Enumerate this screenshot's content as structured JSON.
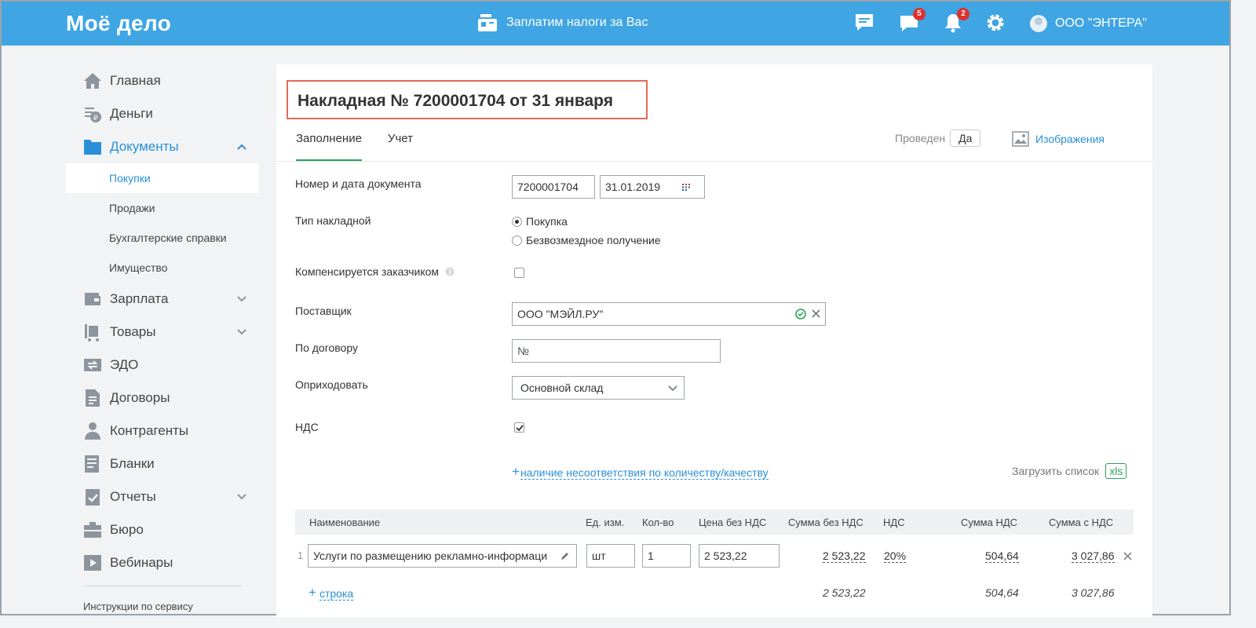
{
  "header": {
    "logo": "Моё дело",
    "tax_label": "Заплатим налоги за Вас",
    "messages_badge": "5",
    "notifications_badge": "2",
    "company": "ООО \"ЭНТЕРА\""
  },
  "sidebar": {
    "items": [
      {
        "label": "Главная"
      },
      {
        "label": "Деньги"
      },
      {
        "label": "Документы"
      },
      {
        "label": "Зарплата"
      },
      {
        "label": "Товары"
      },
      {
        "label": "ЭДО"
      },
      {
        "label": "Договоры"
      },
      {
        "label": "Контрагенты"
      },
      {
        "label": "Бланки"
      },
      {
        "label": "Отчеты"
      },
      {
        "label": "Бюро"
      },
      {
        "label": "Вебинары"
      }
    ],
    "sub": [
      "Покупки",
      "Продажи",
      "Бухгалтерские справки",
      "Имущество"
    ],
    "help": "Инструкции по сервису"
  },
  "doc": {
    "title": "Накладная № 7200001704 от 31 января",
    "tabs": [
      "Заполнение",
      "Учет"
    ],
    "posted_label": "Проведен",
    "posted_value": "Да",
    "images_label": "Изображения"
  },
  "form": {
    "number_label": "Номер и дата документа",
    "number": "7200001704",
    "date": "31.01.2019",
    "type_label": "Тип накладной",
    "type_options": [
      "Покупка",
      "Безвозмездное получение"
    ],
    "compensate_label": "Компенсируется заказчиком",
    "supplier_label": "Поставщик",
    "supplier": "ООО \"МЭЙЛ.РУ\"",
    "contract_label": "По договору",
    "contract": "№",
    "stock_label": "Оприходовать",
    "stock": "Основной склад",
    "vat_label": "НДС",
    "mismatch_link": "наличие несоответствия по количеству/качеству",
    "upload_label": "Загрузить список",
    "xls": "xls"
  },
  "table": {
    "headers": [
      "Наименование",
      "Ед. изм.",
      "Кол-во",
      "Цена без НДС",
      "Сумма без НДС",
      "НДС",
      "Сумма НДС",
      "Сумма с НДС"
    ],
    "row": {
      "index": "1",
      "name": "Услуги по размещению рекламно-информаци",
      "unit": "шт",
      "qty": "1",
      "price": "2 523,22",
      "sum_no_vat": "2 523,22",
      "vat": "20%",
      "vat_sum": "504,64",
      "sum_with_vat": "3 027,86"
    },
    "add_row": "строка",
    "totals": {
      "sum_no_vat": "2 523,22",
      "vat_sum": "504,64",
      "sum_with_vat": "3 027,86"
    }
  }
}
